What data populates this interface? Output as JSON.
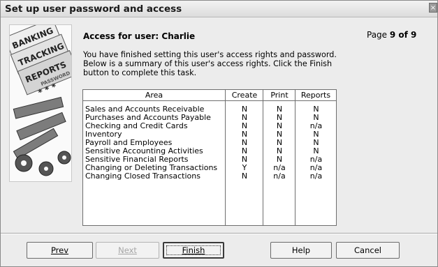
{
  "window": {
    "title": "Set up user password and access",
    "close_glyph": "×"
  },
  "header": {
    "access_heading": "Access for user: Charlie",
    "page_prefix": "Page",
    "page_value": "9 of 9"
  },
  "summary_lines": [
    "You have finished setting this user's access rights and password.",
    "Below is a summary of this user's access rights.  Click the Finish",
    "button to complete this task."
  ],
  "illustration": {
    "tabs": [
      "BANKING",
      "TRACKING",
      "REPORTS",
      "PASSWORD",
      "* * *"
    ]
  },
  "table": {
    "columns": [
      "Area",
      "Create",
      "Print",
      "Reports"
    ],
    "rows": [
      [
        "Sales and Accounts Receivable",
        "N",
        "N",
        "N"
      ],
      [
        "Purchases and Accounts Payable",
        "N",
        "N",
        "N"
      ],
      [
        "Checking and Credit Cards",
        "N",
        "N",
        "n/a"
      ],
      [
        "Inventory",
        "N",
        "N",
        "N"
      ],
      [
        "Payroll and Employees",
        "N",
        "N",
        "N"
      ],
      [
        "Sensitive Accounting Activities",
        "N",
        "N",
        "N"
      ],
      [
        "Sensitive Financial Reports",
        "N",
        "N",
        "n/a"
      ],
      [
        "Changing or Deleting Transactions",
        "Y",
        "n/a",
        "n/a"
      ],
      [
        "Changing Closed Transactions",
        "N",
        "n/a",
        "n/a"
      ]
    ]
  },
  "buttons": {
    "prev": "Prev",
    "next": "Next",
    "finish": "Finish",
    "help": "Help",
    "cancel": "Cancel"
  }
}
